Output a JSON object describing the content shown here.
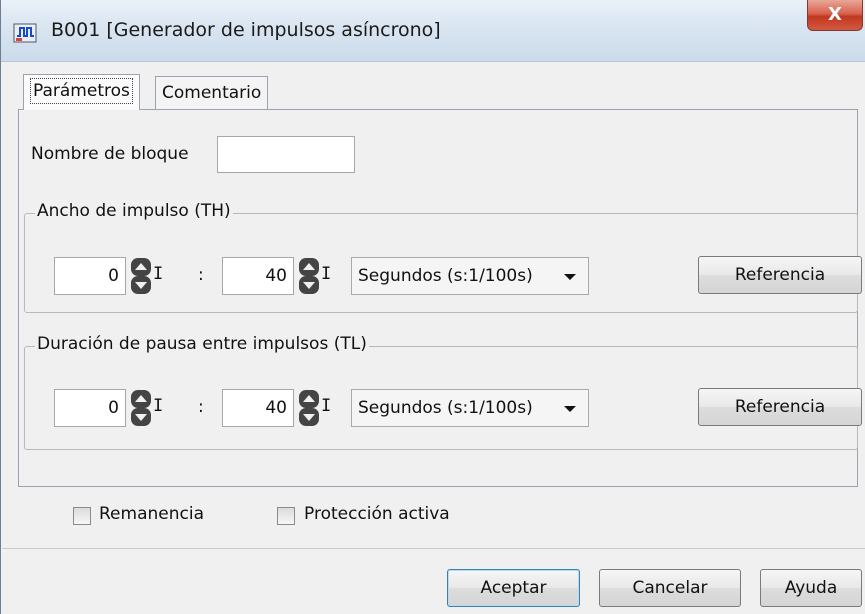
{
  "window": {
    "title": "B001 [Generador de impulsos asíncrono]",
    "close_label": "X"
  },
  "tabs": [
    {
      "label": "Parámetros",
      "active": true
    },
    {
      "label": "Comentario",
      "active": false
    }
  ],
  "block_name": {
    "label": "Nombre de bloque",
    "value": ""
  },
  "th": {
    "legend": "Ancho de impulso (TH)",
    "value_a": "0",
    "value_b": "40",
    "separator": ":",
    "unit": "Segundos (s:1/100s)",
    "reference_label": "Referencia"
  },
  "tl": {
    "legend": "Duración de pausa entre impulsos (TL)",
    "value_a": "0",
    "value_b": "40",
    "separator": ":",
    "unit": "Segundos (s:1/100s)",
    "reference_label": "Referencia"
  },
  "spinner_suffix": "I",
  "options": {
    "retentivity": {
      "label": "Remanencia",
      "checked": false
    },
    "protection": {
      "label": "Protección activa",
      "checked": false
    }
  },
  "footer": {
    "ok": "Aceptar",
    "cancel": "Cancelar",
    "help": "Ayuda"
  }
}
